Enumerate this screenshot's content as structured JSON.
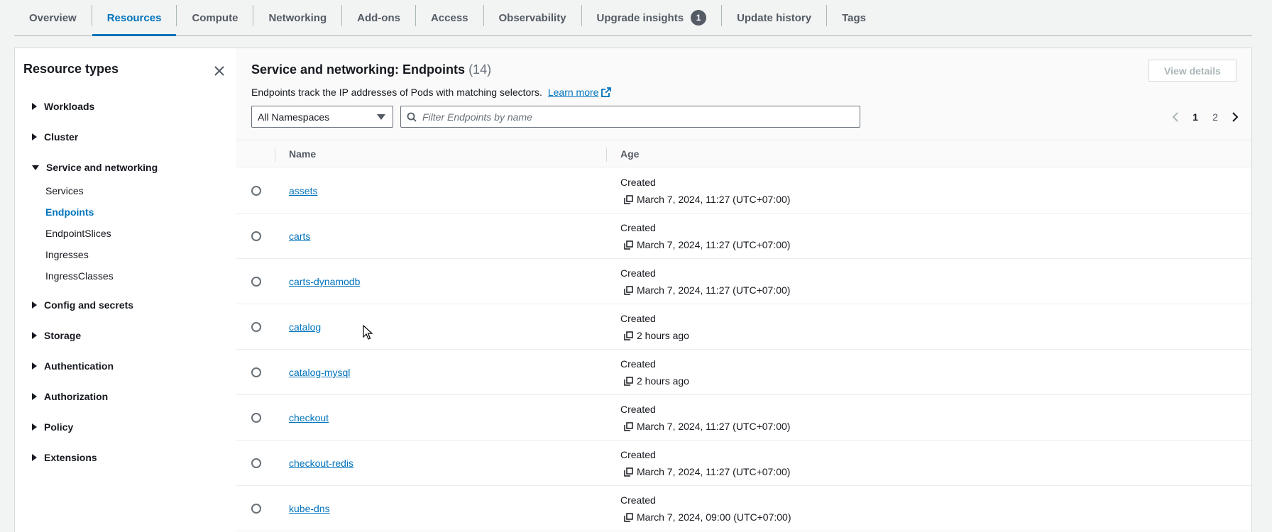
{
  "tabs": [
    {
      "label": "Overview",
      "active": false
    },
    {
      "label": "Resources",
      "active": true
    },
    {
      "label": "Compute",
      "active": false
    },
    {
      "label": "Networking",
      "active": false
    },
    {
      "label": "Add-ons",
      "active": false
    },
    {
      "label": "Access",
      "active": false
    },
    {
      "label": "Observability",
      "active": false
    },
    {
      "label": "Upgrade insights",
      "active": false,
      "badge": "1"
    },
    {
      "label": "Update history",
      "active": false
    },
    {
      "label": "Tags",
      "active": false
    }
  ],
  "sidebar": {
    "title": "Resource types",
    "groups": [
      {
        "label": "Workloads",
        "expanded": false
      },
      {
        "label": "Cluster",
        "expanded": false
      },
      {
        "label": "Service and networking",
        "expanded": true,
        "items": [
          {
            "label": "Services",
            "active": false
          },
          {
            "label": "Endpoints",
            "active": true
          },
          {
            "label": "EndpointSlices",
            "active": false
          },
          {
            "label": "Ingresses",
            "active": false
          },
          {
            "label": "IngressClasses",
            "active": false
          }
        ]
      },
      {
        "label": "Config and secrets",
        "expanded": false
      },
      {
        "label": "Storage",
        "expanded": false
      },
      {
        "label": "Authentication",
        "expanded": false
      },
      {
        "label": "Authorization",
        "expanded": false
      },
      {
        "label": "Policy",
        "expanded": false
      },
      {
        "label": "Extensions",
        "expanded": false
      }
    ]
  },
  "main": {
    "title": "Service and networking: Endpoints",
    "count": "(14)",
    "description": "Endpoints track the IP addresses of Pods with matching selectors.",
    "learn_more": "Learn more",
    "view_details": "View details",
    "namespace_select": "All Namespaces",
    "filter_placeholder": "Filter Endpoints by name",
    "pages": [
      "1",
      "2"
    ],
    "current_page": "1",
    "columns": {
      "name": "Name",
      "age": "Age"
    },
    "rows": [
      {
        "name": "assets",
        "age_label": "Created",
        "age": "March 7, 2024, 11:27 (UTC+07:00)"
      },
      {
        "name": "carts",
        "age_label": "Created",
        "age": "March 7, 2024, 11:27 (UTC+07:00)"
      },
      {
        "name": "carts-dynamodb",
        "age_label": "Created",
        "age": "March 7, 2024, 11:27 (UTC+07:00)"
      },
      {
        "name": "catalog",
        "age_label": "Created",
        "age": "2 hours ago"
      },
      {
        "name": "catalog-mysql",
        "age_label": "Created",
        "age": "2 hours ago"
      },
      {
        "name": "checkout",
        "age_label": "Created",
        "age": "March 7, 2024, 11:27 (UTC+07:00)"
      },
      {
        "name": "checkout-redis",
        "age_label": "Created",
        "age": "March 7, 2024, 11:27 (UTC+07:00)"
      },
      {
        "name": "kube-dns",
        "age_label": "Created",
        "age": "March 7, 2024, 09:00 (UTC+07:00)"
      }
    ]
  },
  "colors": {
    "accent": "#0073bb",
    "text": "#16191f",
    "muted": "#545b64",
    "border": "#d5dbdb"
  }
}
